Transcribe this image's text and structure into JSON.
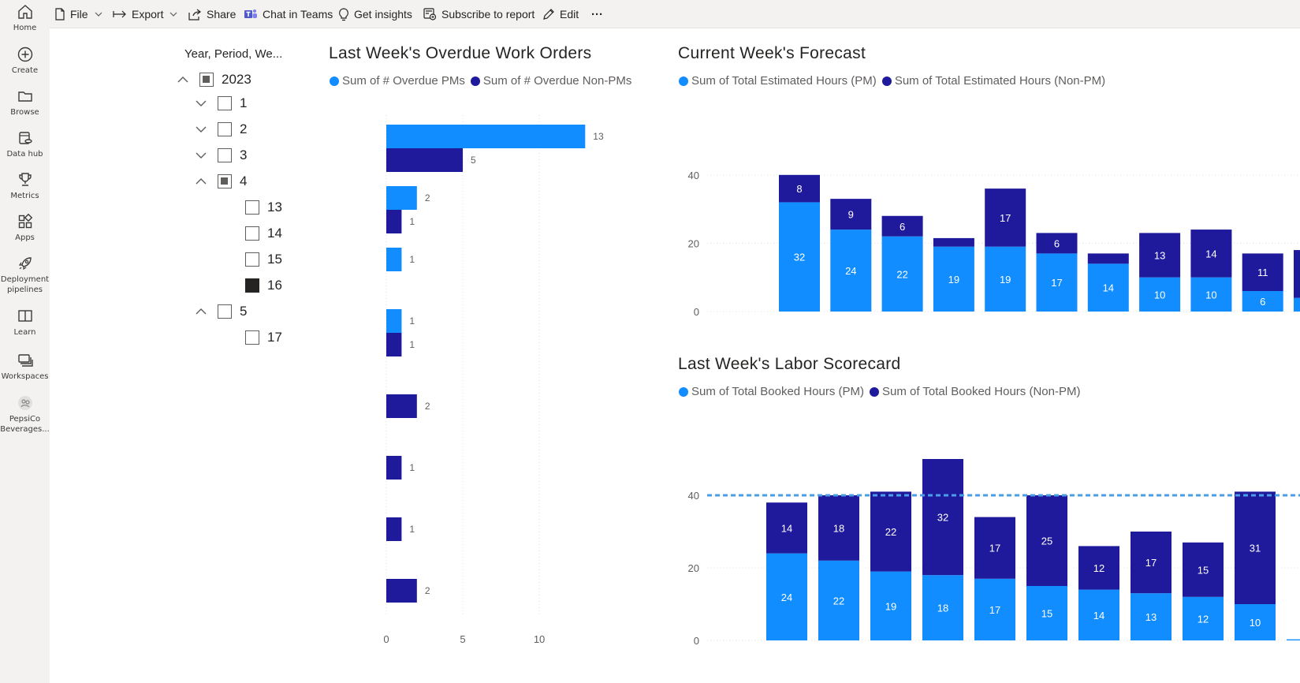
{
  "nav": {
    "items": [
      {
        "label": "Home",
        "icon": "home-icon"
      },
      {
        "label": "Create",
        "icon": "plus-circle-icon"
      },
      {
        "label": "Browse",
        "icon": "folder-icon"
      },
      {
        "label": "Data hub",
        "icon": "data-hub-icon"
      },
      {
        "label": "Metrics",
        "icon": "trophy-icon"
      },
      {
        "label": "Apps",
        "icon": "apps-icon"
      },
      {
        "label": "Deployment pipelines",
        "label_line1": "Deployment",
        "label_line2": "pipelines",
        "icon": "rocket-icon"
      },
      {
        "label": "Learn",
        "icon": "book-icon"
      },
      {
        "label": "Workspaces",
        "icon": "workspaces-icon"
      },
      {
        "label": "PepsiCo Beverages...",
        "label_line1": "PepsiCo",
        "label_line2": "Beverages...",
        "icon": "workspace-avatar-icon"
      }
    ]
  },
  "toolbar": {
    "file": "File",
    "export": "Export",
    "share": "Share",
    "teams": "Chat in Teams",
    "insights": "Get insights",
    "subscribe": "Subscribe to report",
    "edit": "Edit",
    "more": "···"
  },
  "slicer": {
    "title": "Year, Period, We...",
    "items": [
      {
        "label": "2023",
        "level": 0,
        "expanded": true,
        "state": "partial"
      },
      {
        "label": "1",
        "level": 1,
        "expanded": false,
        "state": "unchecked"
      },
      {
        "label": "2",
        "level": 1,
        "expanded": false,
        "state": "unchecked"
      },
      {
        "label": "3",
        "level": 1,
        "expanded": false,
        "state": "unchecked"
      },
      {
        "label": "4",
        "level": 1,
        "expanded": true,
        "state": "partial"
      },
      {
        "label": "13",
        "level": 2,
        "state": "unchecked"
      },
      {
        "label": "14",
        "level": 2,
        "state": "unchecked"
      },
      {
        "label": "15",
        "level": 2,
        "state": "unchecked"
      },
      {
        "label": "16",
        "level": 2,
        "state": "checked"
      },
      {
        "label": "5",
        "level": 1,
        "expanded": true,
        "state": "unchecked"
      },
      {
        "label": "17",
        "level": 2,
        "state": "unchecked"
      }
    ]
  },
  "colors": {
    "pm": "#118dff",
    "nonpm": "#1f1a9b",
    "axis": "#605e5c",
    "grid": "#e1dfdd",
    "target": "#4a9ee8"
  },
  "chart_data": [
    {
      "id": "overdue",
      "type": "bar",
      "orientation": "horizontal",
      "title": "Last Week's Overdue Work Orders",
      "legend": [
        "Sum of # Overdue PMs",
        "Sum of # Overdue Non-PMs"
      ],
      "series": [
        {
          "name": "Sum of # Overdue PMs",
          "values": [
            13,
            2,
            1,
            1,
            null,
            null,
            null,
            null
          ]
        },
        {
          "name": "Sum of # Overdue Non-PMs",
          "values": [
            5,
            1,
            null,
            1,
            2,
            1,
            1,
            2
          ]
        }
      ],
      "xlim": [
        0,
        13.5
      ],
      "xticks": [
        0,
        5,
        10
      ],
      "grid": true
    },
    {
      "id": "forecast",
      "type": "bar",
      "stacked": true,
      "title": "Current Week's Forecast",
      "legend": [
        "Sum of Total Estimated Hours (PM)",
        "Sum of Total Estimated Hours (Non-PM)"
      ],
      "series": [
        {
          "name": "Sum of Total Estimated Hours (PM)",
          "values": [
            32,
            24,
            22,
            19,
            19,
            17,
            14,
            10,
            10,
            6,
            4
          ],
          "labels": [
            "32",
            "24",
            "22",
            "19",
            "19",
            "17",
            "14",
            "10",
            "10",
            "6",
            ""
          ]
        },
        {
          "name": "Sum of Total Estimated Hours (Non-PM)",
          "values": [
            8,
            9,
            6,
            2.5,
            17,
            6,
            3,
            13,
            14,
            11,
            14
          ],
          "labels": [
            "8",
            "9",
            "6",
            "",
            "17",
            "6",
            "",
            "13",
            "14",
            "11",
            "14"
          ]
        }
      ],
      "ylim": [
        0,
        40
      ],
      "yticks": [
        0,
        20,
        40
      ],
      "grid": true
    },
    {
      "id": "labor",
      "type": "bar",
      "stacked": true,
      "title": "Last Week's Labor Scorecard",
      "legend": [
        "Sum of Total Booked Hours (PM)",
        "Sum of Total Booked Hours (Non-PM)"
      ],
      "series": [
        {
          "name": "Sum of Total Booked Hours (PM)",
          "values": [
            24,
            22,
            19,
            18,
            17,
            15,
            14,
            13,
            12,
            10,
            0.3
          ],
          "labels": [
            "24",
            "22",
            "19",
            "18",
            "17",
            "15",
            "14",
            "13",
            "12",
            "10",
            ""
          ]
        },
        {
          "name": "Sum of Total Booked Hours (Non-PM)",
          "values": [
            14,
            18,
            22,
            32,
            17,
            25,
            12,
            17,
            15,
            31,
            0
          ],
          "labels": [
            "14",
            "18",
            "22",
            "32",
            "17",
            "25",
            "12",
            "17",
            "15",
            "31",
            ""
          ]
        }
      ],
      "target_line": 40,
      "ylim": [
        0,
        40
      ],
      "yticks": [
        0,
        20,
        40
      ],
      "grid": true
    }
  ]
}
